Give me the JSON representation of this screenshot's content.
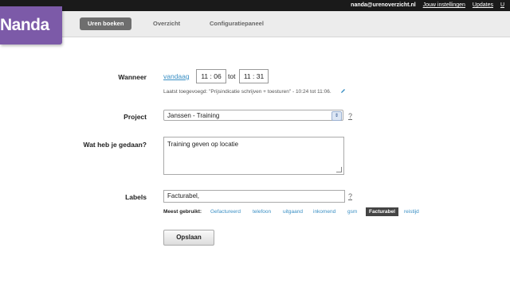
{
  "topbar": {
    "email": "nanda@urenoverzicht.nl",
    "links": [
      "Jouw instellingen",
      "Updates",
      "U"
    ]
  },
  "logo": {
    "text": "Nanda"
  },
  "nav": {
    "items": [
      "Uren boeken",
      "Overzicht",
      "Configuratiepaneel"
    ],
    "active": "Uren boeken"
  },
  "form": {
    "wanneer": {
      "label": "Wanneer",
      "date_link": "vandaag",
      "start": "11 : 06",
      "separator": "tot",
      "end": "11 : 31",
      "last_added": "Laatst toegevoegd: \"Prijsindicatie schrijven + toesturen\" - 10:24 tot 11:06."
    },
    "project": {
      "label": "Project",
      "value": "Janssen - Training",
      "help": "?"
    },
    "description": {
      "label": "Wat heb je gedaan?",
      "value": "Training geven op locatie"
    },
    "labels": {
      "label": "Labels",
      "value": "Facturabel,",
      "help": "?",
      "most_used_label": "Meest gebruikt:",
      "tags": [
        "Gefactureerd",
        "telefoon",
        "uitgaand",
        "inkomend",
        "gsm",
        "Facturabel",
        "reistijd"
      ],
      "active_tag": "Facturabel"
    },
    "save_label": "Opslaan"
  },
  "colors": {
    "brand": "#7c5aa8",
    "link": "#3a8fc4",
    "nav_active": "#6e6e6e",
    "topbar": "#1a1a1a"
  }
}
